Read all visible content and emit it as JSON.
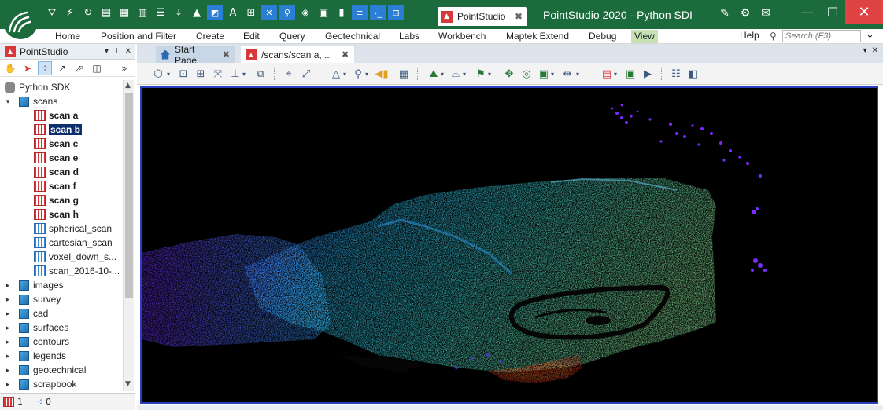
{
  "app": {
    "window_title": "PointStudio 2020 - Python SDI",
    "document_tab_label": "PointStudio",
    "colors": {
      "title_bg": "#1c6b3c",
      "accent_red": "#d9383a",
      "viewport_bg": "#000000",
      "selection": "#0e2f6e",
      "active_ribbon_tab": "#c6e2b5"
    }
  },
  "ribbon": {
    "tabs": [
      {
        "label": "Home"
      },
      {
        "label": "Position and Filter"
      },
      {
        "label": "Create"
      },
      {
        "label": "Edit"
      },
      {
        "label": "Query"
      },
      {
        "label": "Geotechnical"
      },
      {
        "label": "Labs"
      },
      {
        "label": "Workbench"
      },
      {
        "label": "Maptek Extend"
      },
      {
        "label": "Debug"
      },
      {
        "label": "View"
      }
    ],
    "active_tab": "View",
    "help_label": "Help",
    "search_placeholder": "Search (F3)"
  },
  "left_panel": {
    "title": "PointStudio",
    "tree": [
      {
        "label": "Python SDK",
        "type": "root",
        "toggle": ""
      },
      {
        "label": "scans",
        "type": "folder",
        "toggle": "▾"
      },
      {
        "label": "scan a",
        "type": "scan-red",
        "bold": true
      },
      {
        "label": "scan b",
        "type": "scan-red",
        "bold": true,
        "selected": true
      },
      {
        "label": "scan c",
        "type": "scan-red",
        "bold": true
      },
      {
        "label": "scan e",
        "type": "scan-red",
        "bold": true
      },
      {
        "label": "scan d",
        "type": "scan-red",
        "bold": true
      },
      {
        "label": "scan f",
        "type": "scan-red",
        "bold": true
      },
      {
        "label": "scan g",
        "type": "scan-red",
        "bold": true
      },
      {
        "label": "scan h",
        "type": "scan-red",
        "bold": true
      },
      {
        "label": "spherical_scan",
        "type": "scan-blue"
      },
      {
        "label": "cartesian_scan",
        "type": "scan-blue"
      },
      {
        "label": "voxel_down_s...",
        "type": "scan-blue"
      },
      {
        "label": "scan_2016-10-...",
        "type": "scan-blue"
      },
      {
        "label": "images",
        "type": "folder",
        "toggle": "▸"
      },
      {
        "label": "survey",
        "type": "folder",
        "toggle": "▸"
      },
      {
        "label": "cad",
        "type": "folder",
        "toggle": "▸"
      },
      {
        "label": "surfaces",
        "type": "folder",
        "toggle": "▸"
      },
      {
        "label": "contours",
        "type": "folder",
        "toggle": "▸"
      },
      {
        "label": "legends",
        "type": "folder",
        "toggle": "▸"
      },
      {
        "label": "geotechnical",
        "type": "folder",
        "toggle": "▸"
      },
      {
        "label": "scrapbook",
        "type": "folder",
        "toggle": "▸"
      }
    ]
  },
  "doc_tabs": [
    {
      "label": "Start Page"
    },
    {
      "label": "/scans/scan a, ..."
    }
  ],
  "status": {
    "selected_count": "1",
    "points_count": "0"
  }
}
